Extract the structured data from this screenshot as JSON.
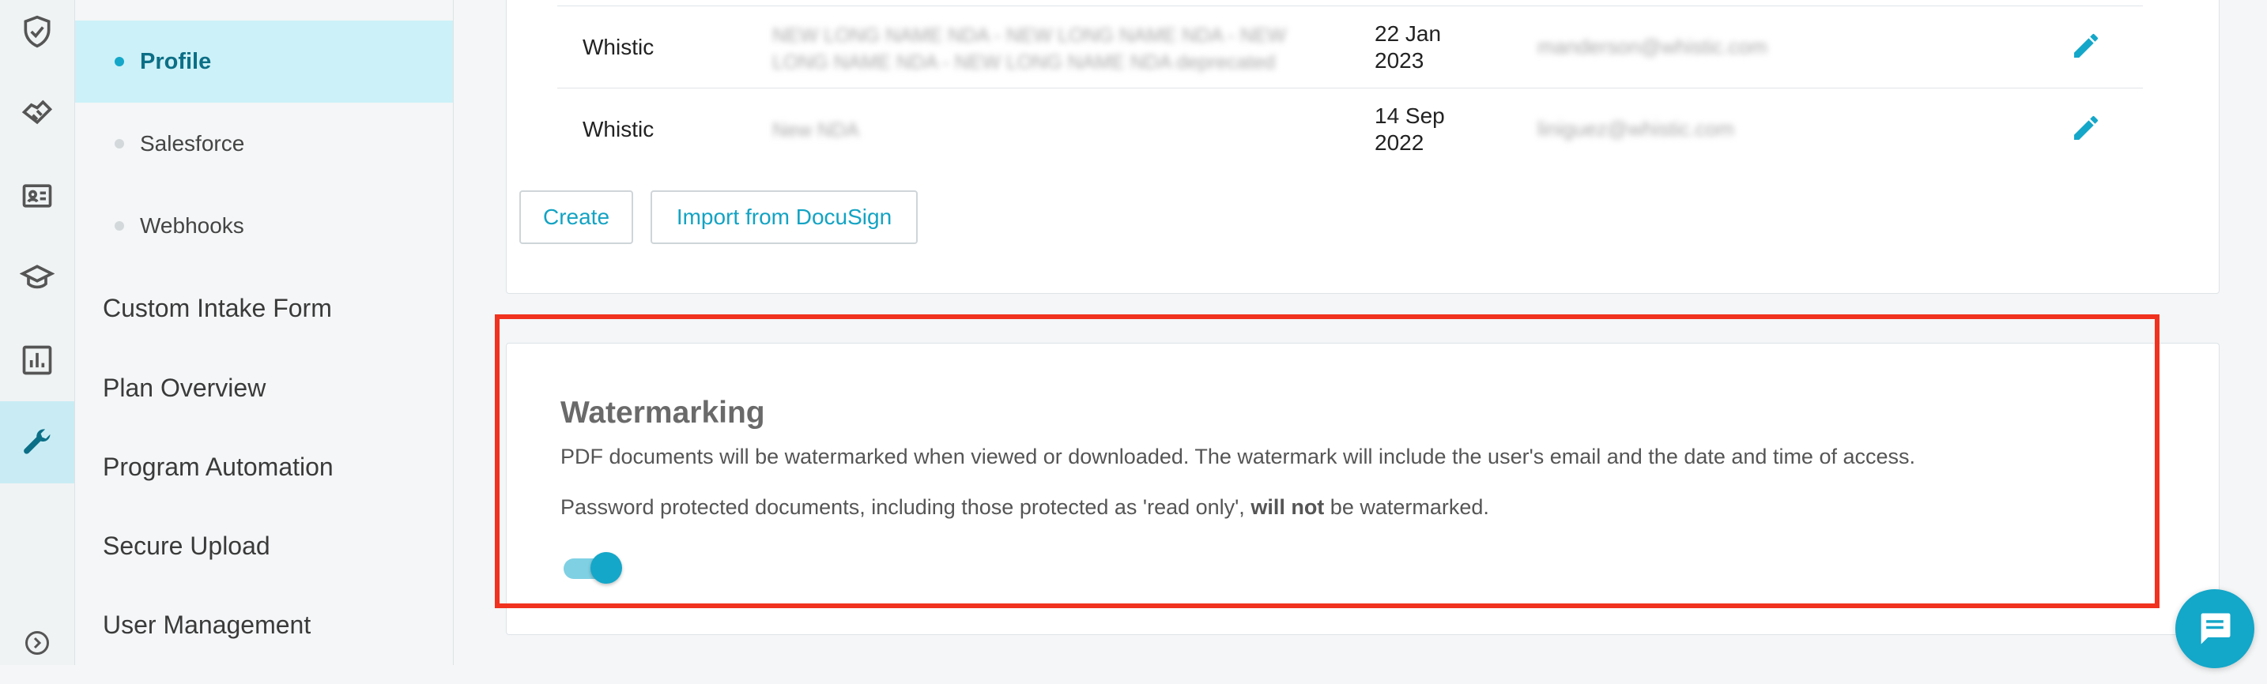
{
  "rail": {
    "icons": [
      "shield-check-icon",
      "handshake-icon",
      "id-card-icon",
      "graduation-cap-icon",
      "bar-chart-icon",
      "wrench-icon",
      "expand-circle-icon"
    ],
    "active": "wrench-icon"
  },
  "nav": {
    "sub_items": [
      {
        "label": "Profile",
        "active": true
      },
      {
        "label": "Salesforce",
        "active": false
      },
      {
        "label": "Webhooks",
        "active": false
      }
    ],
    "main_items": [
      "Custom Intake Form",
      "Plan Overview",
      "Program Automation",
      "Secure Upload",
      "User Management"
    ]
  },
  "nda_table": {
    "rows": [
      {
        "company": "Whistic",
        "name": "NEW LONG NAME NDA - NEW LONG NAME NDA - NEW LONG NAME NDA - NEW LONG NAME NDA deprecated",
        "date": "22 Jan 2023",
        "email": "manderson@whistic.com"
      },
      {
        "company": "Whistic",
        "name": "New NDA",
        "date": "14 Sep 2022",
        "email": "liniguez@whistic.com"
      }
    ],
    "create_label": "Create",
    "import_label": "Import from DocuSign"
  },
  "watermarking": {
    "title": "Watermarking",
    "description": "PDF documents will be watermarked when viewed or downloaded. The watermark will include the user's email and the date and time of access.",
    "note_prefix": "Password protected documents, including those protected as 'read only', ",
    "note_bold": "will not",
    "note_suffix": " be watermarked.",
    "enabled": true
  },
  "colors": {
    "accent": "#14a7c9",
    "highlight": "#f0321f",
    "active_nav_bg": "#cdf1f8"
  }
}
